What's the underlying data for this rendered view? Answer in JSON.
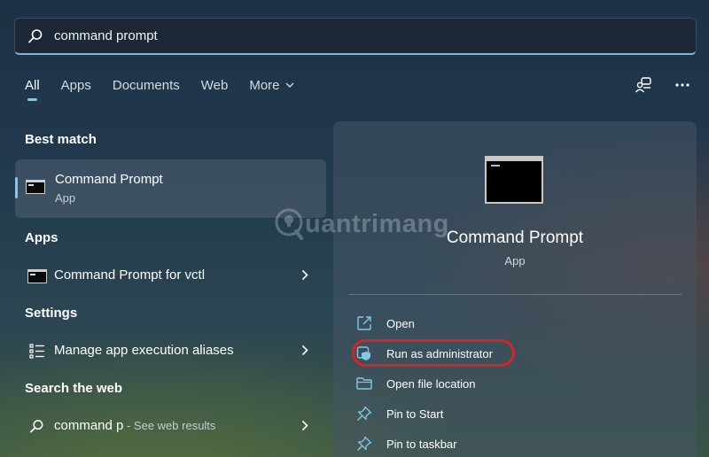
{
  "search": {
    "query": "command prompt"
  },
  "tabs": [
    {
      "label": "All",
      "active": true
    },
    {
      "label": "Apps",
      "active": false
    },
    {
      "label": "Documents",
      "active": false
    },
    {
      "label": "Web",
      "active": false
    },
    {
      "label": "More",
      "active": false
    }
  ],
  "top_icons": [
    "switch-account-icon",
    "more-options-icon"
  ],
  "sections": {
    "best_match": "Best match",
    "apps": "Apps",
    "settings": "Settings",
    "search_web": "Search the web"
  },
  "best_match": {
    "title": "Command Prompt",
    "subtitle": "App",
    "icon": "command-prompt-icon"
  },
  "apps": [
    {
      "label": "Command Prompt for vctl",
      "icon": "command-prompt-icon"
    }
  ],
  "settings": [
    {
      "label": "Manage app execution aliases",
      "icon": "list-icon"
    }
  ],
  "web": {
    "query": "command p",
    "hint": " - See web results",
    "icon": "search-icon"
  },
  "preview": {
    "title": "Command Prompt",
    "subtitle": "App",
    "actions": [
      {
        "label": "Open",
        "icon": "open-external-icon"
      },
      {
        "label": "Run as administrator",
        "icon": "admin-shield-icon"
      },
      {
        "label": "Open file location",
        "icon": "folder-icon"
      },
      {
        "label": "Pin to Start",
        "icon": "pin-icon"
      },
      {
        "label": "Pin to taskbar",
        "icon": "pin-icon"
      }
    ]
  },
  "watermark": {
    "text": "uantrimang"
  },
  "colors": {
    "accent": "#7ec8e8",
    "highlight_ring": "#d52424"
  }
}
